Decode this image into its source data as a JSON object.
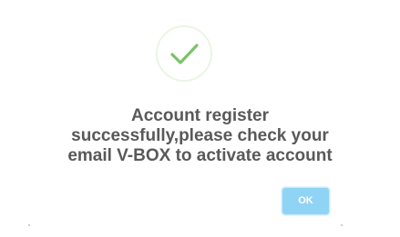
{
  "dialog": {
    "icon": "checkmark-icon",
    "accent_color": "#8fd4f5",
    "success_color": "#7ac36a",
    "message_lines": [
      "Account register",
      "successfully,please check your",
      "email V-BOX to activate account"
    ],
    "ok_label": "OK"
  }
}
